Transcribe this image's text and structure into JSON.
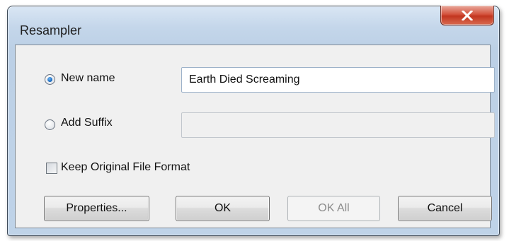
{
  "window": {
    "title": "Resampler",
    "close_glyph": "X"
  },
  "options": {
    "new_name": {
      "label": "New name",
      "selected": true,
      "value": "Earth Died Screaming"
    },
    "add_suffix": {
      "label": "Add Suffix",
      "selected": false,
      "value": ""
    },
    "keep_format": {
      "label": "Keep Original File Format",
      "checked": false
    }
  },
  "buttons": {
    "properties": "Properties...",
    "ok": "OK",
    "ok_all": "OK All",
    "cancel": "Cancel"
  },
  "icons": {
    "close": "close-icon"
  },
  "colors": {
    "close_button": "#c9452f",
    "radio_selected": "#1e6fc4"
  }
}
